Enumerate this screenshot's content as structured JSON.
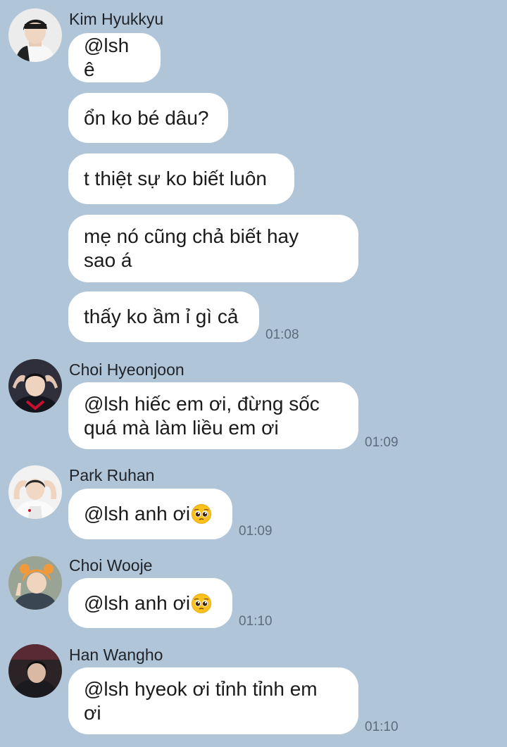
{
  "messages": [
    {
      "sender": "Kim Hyukkyu",
      "bubbles": [
        {
          "text": "@lsh ê"
        },
        {
          "text": "ổn ko bé dâu?"
        },
        {
          "text": "t thiệt sự ko biết luôn"
        },
        {
          "text": "mẹ nó cũng chả biết hay\nsao á"
        },
        {
          "text": "thấy ko ầm ỉ gì cả"
        }
      ],
      "time": "01:08"
    },
    {
      "sender": "Choi Hyeonjoon",
      "bubbles": [
        {
          "text": "@lsh hiếc em ơi, đừng sốc\nquá mà làm liều em ơi"
        }
      ],
      "time": "01:09"
    },
    {
      "sender": "Park Ruhan",
      "bubbles": [
        {
          "text": "@lsh anh ơi",
          "emoji": "pleading-face-emoji"
        }
      ],
      "time": "01:09"
    },
    {
      "sender": "Choi Wooje",
      "bubbles": [
        {
          "text": "@lsh anh ơi",
          "emoji": "pleading-face-emoji"
        }
      ],
      "time": "01:10"
    },
    {
      "sender": "Han Wangho",
      "bubbles": [
        {
          "text": "@lsh hyeok ơi tỉnh tỉnh em\nơi"
        }
      ],
      "time": "01:10"
    }
  ],
  "colors": {
    "background": "#b1c5d9",
    "bubble": "#ffffff",
    "time_text": "#5d6c7c"
  }
}
